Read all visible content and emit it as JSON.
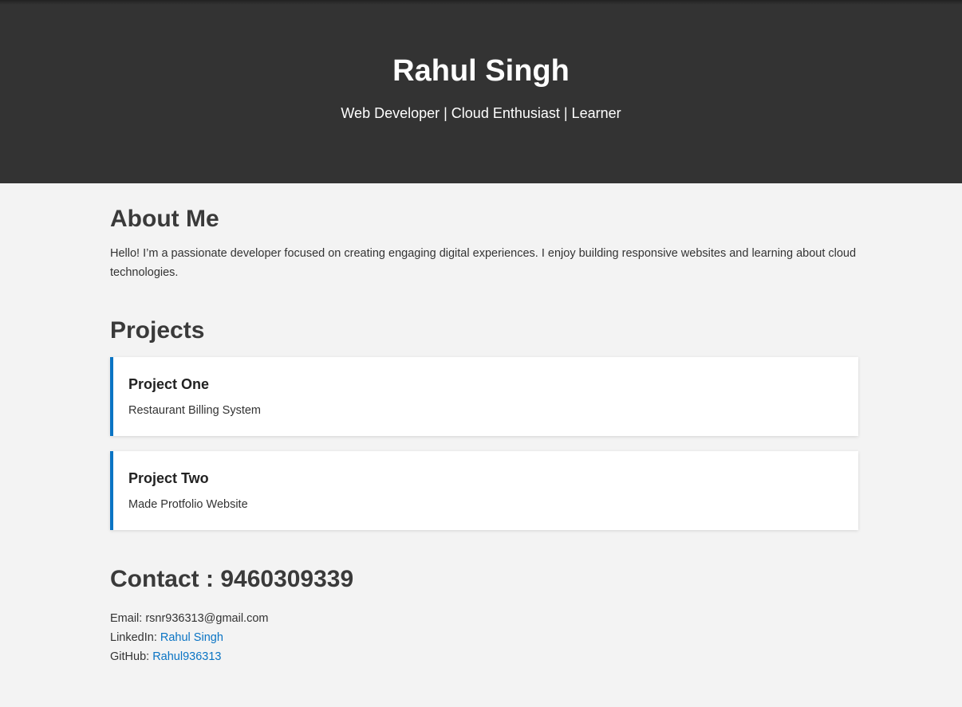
{
  "header": {
    "name": "Rahul Singh",
    "tagline": "Web Developer | Cloud Enthusiast | Learner"
  },
  "about": {
    "title": "About Me",
    "text": "Hello! I’m a passionate developer focused on creating engaging digital experiences. I enjoy building responsive websites and learning about cloud technologies."
  },
  "projects": {
    "title": "Projects",
    "items": [
      {
        "name": "Project One",
        "description": "Restaurant Billing System"
      },
      {
        "name": "Project Two",
        "description": "Made Protfolio Website"
      }
    ]
  },
  "contact": {
    "title": "Contact : 9460309339",
    "email_label": "Email:",
    "email": "rsnr936313@gmail.com",
    "linkedin_label": "LinkedIn:",
    "linkedin_text": "Rahul Singh",
    "github_label": "GitHub:",
    "github_text": "Rahul936313"
  },
  "colors": {
    "header_bg": "#333333",
    "page_bg": "#f3f3f3",
    "accent": "#0a74c4"
  }
}
